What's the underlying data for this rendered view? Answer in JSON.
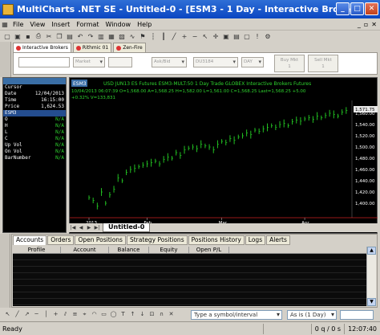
{
  "window": {
    "title": "MultiCharts .NET SE - Untitled-0 - [ESM3 - 1 Day - Interactive Brokers]",
    "min": "_",
    "max": "□",
    "close": "✕"
  },
  "menu": {
    "items": [
      "File",
      "View",
      "Insert",
      "Format",
      "Window",
      "Help"
    ],
    "mdi": [
      "_",
      "▫",
      "✕"
    ]
  },
  "broker_tabs": [
    {
      "label": "Interactive Brokers",
      "active": true
    },
    {
      "label": "Rithmic 01",
      "active": false
    },
    {
      "label": "Zen-Fire",
      "active": false
    }
  ],
  "order_bar": {
    "order_type": "Market",
    "price_type": "Ask/Bid",
    "quantity": "DU3184",
    "tif": "DAY",
    "buy_label": "Buy Mkt",
    "buy_sub": "1",
    "sell_label": "Sell Mkt",
    "sell_sub": "1"
  },
  "data_window": {
    "rows": [
      {
        "k": "Cursor",
        "v": ""
      },
      {
        "k": "Date",
        "v": "12/04/2013"
      },
      {
        "k": "Time",
        "v": "16:15:00"
      },
      {
        "k": "Price",
        "v": "1,624.53"
      }
    ],
    "section": "ESM3",
    "fields": [
      {
        "k": "O",
        "v": "N/A"
      },
      {
        "k": "H",
        "v": "N/A"
      },
      {
        "k": "L",
        "v": "N/A"
      },
      {
        "k": "C",
        "v": "N/A"
      },
      {
        "k": "Up Vol",
        "v": "N/A"
      },
      {
        "k": "On Vol",
        "v": "N/A"
      },
      {
        "k": "BarNumber",
        "v": "N/A"
      }
    ]
  },
  "chart": {
    "header1": "USD JUN13 ES Futures ESM3-MULT:50 1 Day Trade GLOBEX Interactive Brokers Futures",
    "header2": "10/04/2013  06:07:39  O=1,568.00  A=1,568.25  H=1,582.00  L=1,561.00  C=1,568.25  Last=1,568.25  +5.00",
    "header3": "+0.32%   V=133,831",
    "symbol_badge": "ESM3",
    "last_price_badge": "1,571.75",
    "month_labels": [
      "2013",
      "Feb",
      "Mar",
      "Apr"
    ],
    "tab_label": "Untitled-0"
  },
  "chart_data": {
    "type": "bar",
    "title": "",
    "xlabel": "",
    "ylabel": "",
    "ylim": [
      1380,
      1580
    ],
    "yticks": [
      1560,
      1540,
      1520,
      1500,
      1480,
      1460,
      1440,
      1420,
      1400
    ],
    "x_labels": [
      "2013",
      "Feb",
      "Mar",
      "Apr"
    ],
    "series": [
      {
        "values": [
          1410,
          1405,
          1395,
          1420,
          1400,
          1415,
          1425,
          1445,
          1440,
          1455,
          1460,
          1462,
          1465,
          1468,
          1470,
          1472,
          1475,
          1470,
          1478,
          1482,
          1480,
          1490,
          1485,
          1495,
          1498,
          1500,
          1497,
          1505,
          1502,
          1500,
          1495,
          1505,
          1510,
          1508,
          1515,
          1512,
          1518,
          1520,
          1525,
          1522,
          1530,
          1528,
          1532,
          1535,
          1538,
          1535,
          1540,
          1542,
          1538,
          1545,
          1548,
          1546,
          1550,
          1552,
          1549,
          1555,
          1552,
          1556,
          1560,
          1558,
          1555,
          1562,
          1565
        ]
      }
    ]
  },
  "tracker": {
    "tabs": [
      "Accounts",
      "Orders",
      "Open Positions",
      "Strategy Positions",
      "Positions History",
      "Logs",
      "Alerts"
    ],
    "columns": [
      "Profile",
      "Account",
      "Balance",
      "Equity",
      "Open P/L"
    ]
  },
  "draw_bar": {
    "symbol_placeholder": "Type a symbol/interval",
    "interval": "As is (1 Day)"
  },
  "status": {
    "ready": "Ready",
    "queue": "0 q / 0 s",
    "time": "12:07:40"
  }
}
